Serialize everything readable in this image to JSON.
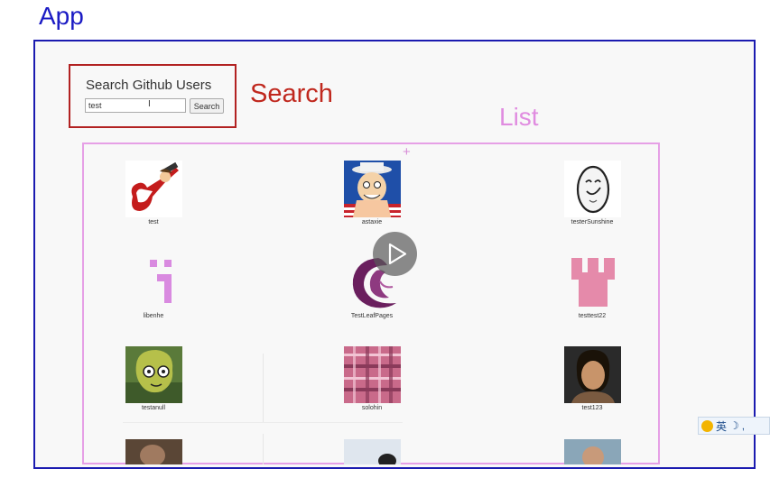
{
  "labels": {
    "app": "App",
    "search": "Search",
    "list": "List"
  },
  "search": {
    "title": "Search Github Users",
    "input_value": "test",
    "button_label": "Search"
  },
  "users": [
    {
      "login": "test"
    },
    {
      "login": "astaxie"
    },
    {
      "login": "testerSunshine"
    },
    {
      "login": "libenhe"
    },
    {
      "login": "TestLeafPages"
    },
    {
      "login": "testtest22"
    },
    {
      "login": "testanull"
    },
    {
      "login": "solohin"
    },
    {
      "login": "test123"
    }
  ],
  "ime": {
    "text": "英",
    "icon": "ime-toolbar-icon"
  },
  "overlay": {
    "icon": "play-icon"
  },
  "colors": {
    "app_outline": "#1b1bb0",
    "search_outline": "#b22222",
    "list_outline": "#e6a0e6"
  }
}
